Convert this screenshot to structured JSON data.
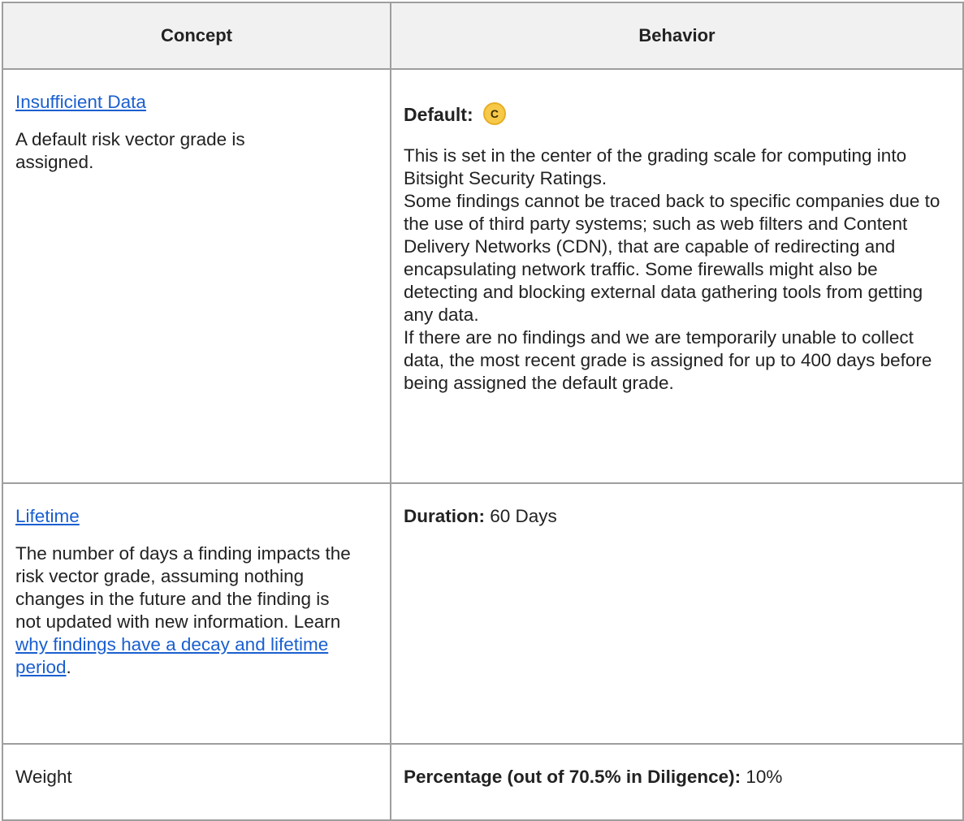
{
  "header": {
    "concept": "Concept",
    "behavior": "Behavior"
  },
  "rows": [
    {
      "concept_link": "Insufficient Data",
      "concept_text": "A default risk vector grade is assigned.",
      "behavior_label": "Default:",
      "grade": "C",
      "paragraphs": [
        "This is set in the center of the grading scale for computing into Bitsight Security Ratings.",
        "Some findings cannot be traced back to specific companies due to the use of third party systems; such as web filters and Content Delivery Networks (CDN), that are capable of redirecting and encapsulating network traffic. Some firewalls might also be detecting and blocking external data gathering tools from getting any data.",
        "If there are no findings and we are temporarily unable to collect data, the most recent grade is assigned for up to 400 days before being assigned the default grade."
      ]
    },
    {
      "concept_link": "Lifetime",
      "concept_text": "The number of days a finding impacts the risk vector grade, assuming nothing changes in the future and the finding is not updated with new information.",
      "learn_prefix": "Learn ",
      "learn_link": "why findings have a decay and lifetime period",
      "learn_suffix": ".",
      "behavior_label": "Duration:",
      "behavior_value": " 60 Days"
    },
    {
      "concept_text": "Weight",
      "behavior_label": "Percentage (out of 70.5% in Diligence):",
      "behavior_value": " 10%"
    }
  ],
  "colors": {
    "link": "#1a5fd0",
    "header_bg": "#f1f1f1",
    "border": "#9e9e9e",
    "grade_badge": "#f7c948"
  }
}
